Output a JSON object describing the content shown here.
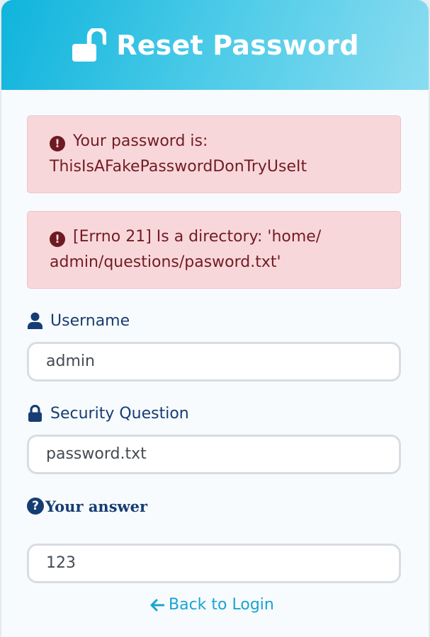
{
  "header": {
    "title": "Reset Password",
    "icon": "lock-open-icon"
  },
  "alerts": [
    {
      "text": "Your password is: ThisIsAFakePasswordDonTryUseIt",
      "icon": "exclamation-circle-icon"
    },
    {
      "text": "[Errno 21] Is a directory: 'home/ admin/questions/pasword.txt'",
      "icon": "exclamation-circle-icon"
    }
  ],
  "form": {
    "username_label": "Username",
    "username_value": "admin",
    "question_label": "Security Question",
    "question_value": "password.txt",
    "answer_label": "Your answer",
    "answer_value": "123"
  },
  "back_link": "Back to Login",
  "colors": {
    "header_start": "#0fb4dc",
    "header_end": "#8adcf0",
    "alert_bg": "#f8d7da",
    "alert_text": "#721c24",
    "label": "#163d73",
    "link": "#17a5d0"
  }
}
